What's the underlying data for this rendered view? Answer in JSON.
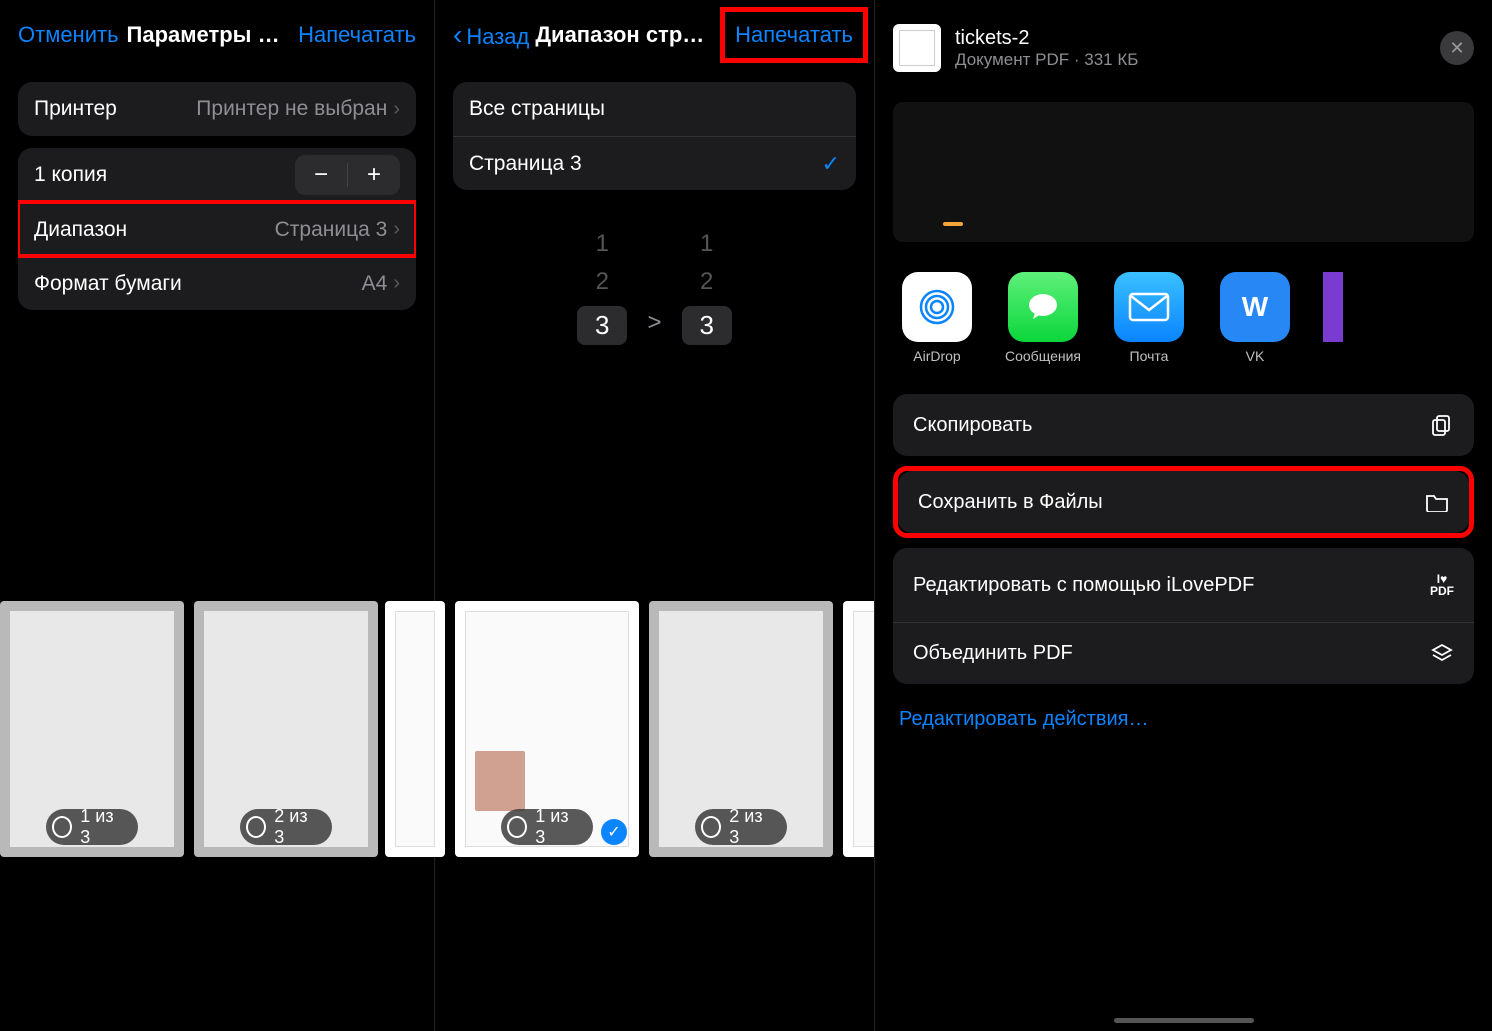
{
  "screen1": {
    "nav": {
      "cancel": "Отменить",
      "title": "Параметры печ...",
      "action": "Напечатать"
    },
    "printer": {
      "label": "Принтер",
      "value": "Принтер не выбран"
    },
    "copies": {
      "label": "1 копия"
    },
    "range": {
      "label": "Диапазон",
      "value": "Страница 3"
    },
    "paper": {
      "label": "Формат бумаги",
      "value": "A4"
    },
    "thumbs": [
      {
        "badge": "1 из 3",
        "selected": false
      },
      {
        "badge": "2 из 3",
        "selected": false
      }
    ]
  },
  "screen2": {
    "nav": {
      "back": "Назад",
      "title": "Диапазон страниц",
      "action": "Напечатать"
    },
    "options": {
      "all": "Все страницы",
      "selected": "Страница 3"
    },
    "picker": {
      "col1": [
        "1",
        "2",
        "3"
      ],
      "arrow": ">",
      "col2": [
        "1",
        "2",
        "3"
      ]
    },
    "thumbs": [
      {
        "badge": "1 из 3",
        "selected": true
      },
      {
        "badge": "2 из 3",
        "selected": false
      }
    ]
  },
  "screen3": {
    "file": {
      "name": "tickets-2",
      "meta": "Документ PDF · 331 КБ"
    },
    "apps": [
      {
        "id": "airdrop",
        "label": "AirDrop"
      },
      {
        "id": "messages",
        "label": "Сообщения"
      },
      {
        "id": "mail",
        "label": "Почта"
      },
      {
        "id": "vk",
        "label": "VK"
      }
    ],
    "actions": {
      "copy": "Скопировать",
      "save": "Сохранить в Файлы",
      "editpdf": "Редактировать с помощью iLovePDF",
      "merge": "Объединить PDF"
    },
    "editActions": "Редактировать действия…"
  }
}
